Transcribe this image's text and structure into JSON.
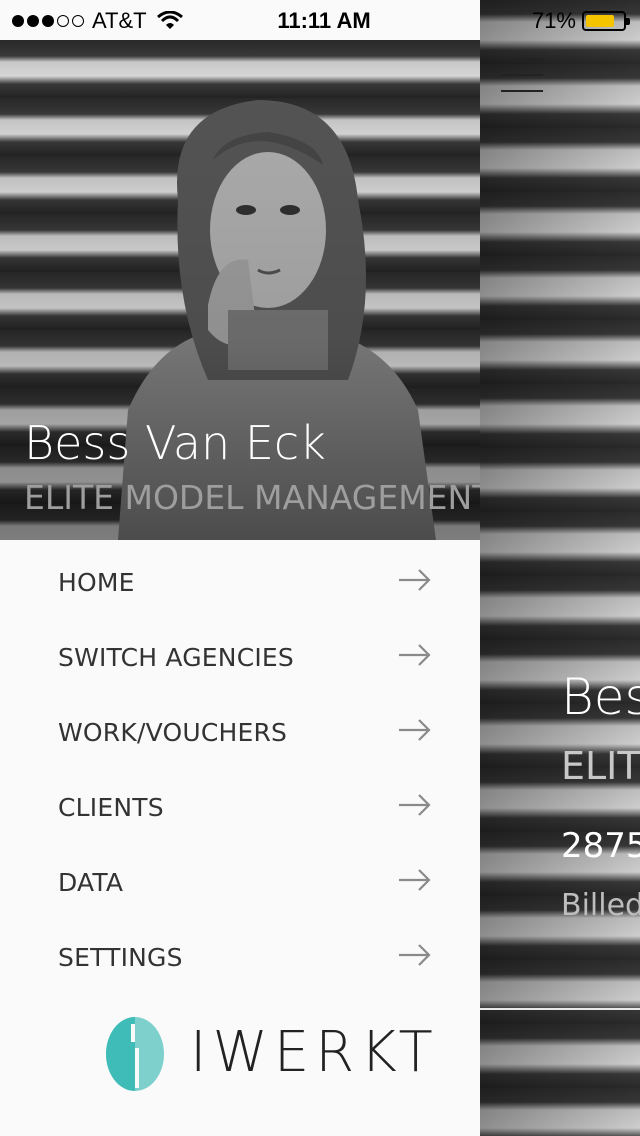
{
  "status_bar": {
    "carrier": "AT&T",
    "time": "11:11 AM",
    "battery": "71%",
    "battery_color": "#f5c400",
    "signal_bars_filled": 3,
    "signal_bars_total": 5
  },
  "drawer": {
    "profile_name": "Bess Van Eck",
    "agency": "ELITE MODEL MANAGEMENT - N",
    "menu": [
      {
        "label": "HOME",
        "icon": "arrow-right-icon"
      },
      {
        "label": "SWITCH AGENCIES",
        "icon": "arrow-right-icon"
      },
      {
        "label": "WORK/VOUCHERS",
        "icon": "arrow-right-icon"
      },
      {
        "label": "CLIENTS",
        "icon": "arrow-right-icon"
      },
      {
        "label": "DATA",
        "icon": "arrow-right-icon"
      },
      {
        "label": "SETTINGS",
        "icon": "arrow-right-icon"
      }
    ],
    "logo_text": "IWERKT",
    "logo_color": "#46c2be"
  },
  "main_screen": {
    "name_partial": "Bes",
    "agency_partial": "ELITE",
    "number_partial": "2875",
    "billed_partial": "Billed"
  }
}
